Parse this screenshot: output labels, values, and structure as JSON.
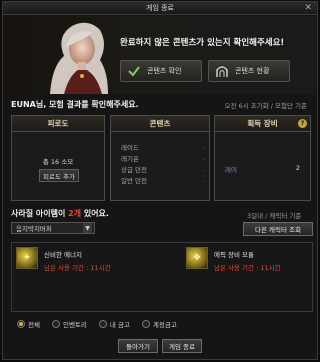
{
  "window": {
    "title": "게임 종료"
  },
  "hero": {
    "message": "완료하지 않은 콘텐츠가 있는지 확인해주세요!",
    "btn_content_check": "콘텐츠 확인",
    "btn_content_status": "콘텐츠 현황"
  },
  "result": {
    "heading": "EUNA님, 모험 결과를 확인해주세요.",
    "meta": "오전 6시 초기화 / 모험단 기준"
  },
  "fatigue": {
    "title": "피로도",
    "total": "총 16 소모",
    "add_btn": "피로도 추가"
  },
  "content": {
    "title": "콘텐츠",
    "items": [
      {
        "label": "레이드",
        "value": "-"
      },
      {
        "label": "레기온",
        "value": "-"
      },
      {
        "label": "상급 던전",
        "value": "-"
      },
      {
        "label": "일반 던전",
        "value": "-"
      }
    ]
  },
  "gear": {
    "title": "획득 장비",
    "help": "?",
    "rows": [
      {
        "label": "레어",
        "value": "2"
      }
    ]
  },
  "lost": {
    "prefix": "사라질 아이템이 ",
    "count": "2개",
    "suffix": " 있어요.",
    "meta": "3일내 / 캐릭터 기준",
    "select_value": "음지박지버퍼",
    "other_btn": "다른 캐릭터 조회"
  },
  "items": [
    {
      "name": "신비한 에너지",
      "period": "남은 사용 기간 : 11시간"
    },
    {
      "name": "에픽 장비 모듈",
      "period": "남은 사용 기간 : 11시간"
    }
  ],
  "filters": [
    {
      "label": "전체",
      "selected": true
    },
    {
      "label": "인벤토리",
      "selected": false
    },
    {
      "label": "내 금고",
      "selected": false
    },
    {
      "label": "계정금고",
      "selected": false
    }
  ],
  "footer": {
    "back": "돌아가기",
    "quit": "게임 종료"
  },
  "colors": {
    "accent_red": "#e24b3a",
    "rare_purple": "#a76be0",
    "gold": "#d9b13b"
  }
}
